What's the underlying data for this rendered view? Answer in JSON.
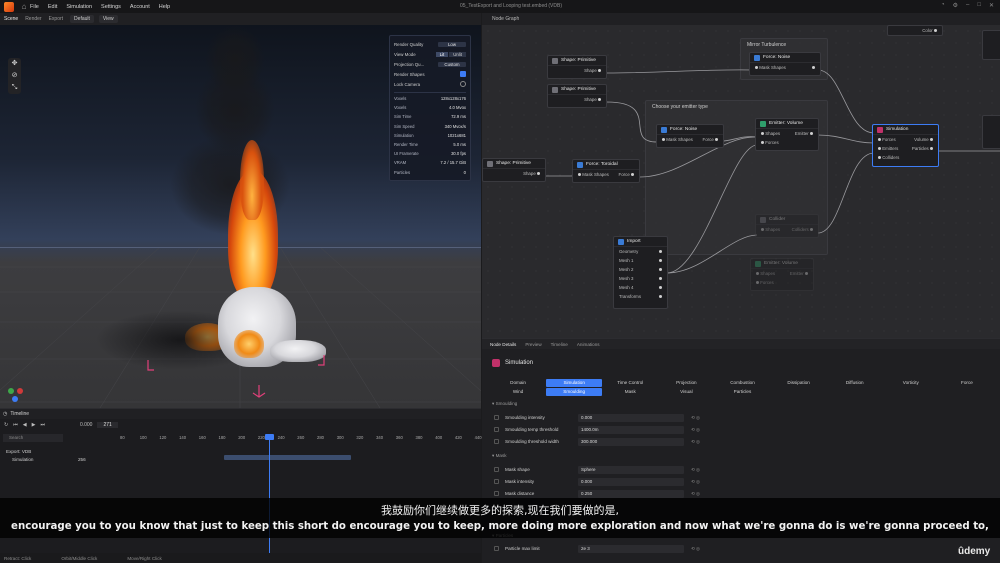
{
  "menu": {
    "items": [
      "File",
      "Edit",
      "Simulation",
      "Settings",
      "Account",
      "Help"
    ],
    "doc_title": "05_TestExport and Looping test.embed  (VDB)"
  },
  "viewport": {
    "tabs": [
      "Scene",
      "Render",
      "Export"
    ],
    "camera_preset": "Default",
    "view_menu": "View"
  },
  "render_panel": {
    "render_quality_label": "Render Quality",
    "render_quality_value": "Low",
    "view_mode_label": "View Mode",
    "view_mode_options": [
      "Lit",
      "Unlit"
    ],
    "projection_label": "Projection Qu...",
    "projection_value": "Custom",
    "render_shapes_label": "Render Shapes",
    "lock_camera_label": "Lock Camera",
    "stats": [
      {
        "label": "Voxels",
        "value": "128x128x176"
      },
      {
        "label": "Voxels",
        "value": "4.0 Mvox"
      },
      {
        "label": "Sim Time",
        "value": "72.9 ms"
      },
      {
        "label": "Sim Speed",
        "value": "340 Mvox/s"
      },
      {
        "label": "Simulation",
        "value": "1021x681"
      },
      {
        "label": "Render Time",
        "value": "5.0 ms"
      },
      {
        "label": "UI Framerate",
        "value": "30.0 fps"
      },
      {
        "label": "VRAM",
        "value": "7.2 / 15.7 GiB"
      },
      {
        "label": "Particles",
        "value": "0"
      }
    ]
  },
  "timeline": {
    "title": "Timeline",
    "current_frame": "271",
    "start_frame": "0.000",
    "search_placeholder": "Search",
    "ruler": [
      "80",
      "100",
      "120",
      "140",
      "160",
      "180",
      "200",
      "220",
      "240",
      "260",
      "280",
      "300",
      "320",
      "340",
      "360",
      "380",
      "400",
      "420",
      "440"
    ],
    "tracks": [
      {
        "label": "Export: VDB",
        "value": ""
      },
      {
        "label": "Simulation",
        "value": "256"
      }
    ]
  },
  "status": {
    "items": [
      "Retract: Click",
      "Orbit/Middle Click",
      "Move/Right Click"
    ]
  },
  "node_graph": {
    "title": "Node Graph",
    "groups": {
      "mirror": "Mirror Turbulence",
      "emitter_type": "Choose your emitter type"
    },
    "nodes": {
      "shape1": {
        "title": "Shape: Primitive",
        "out": "Shape"
      },
      "shape2": {
        "title": "Shape: Primitive",
        "out": "Shape"
      },
      "shape3": {
        "title": "Shape: Primitive",
        "out": "Shape"
      },
      "force_noise_top": {
        "title": "Force: Noise",
        "in": "Mask Shapes"
      },
      "force_noise": {
        "title": "Force: Noise",
        "in": "Mask Shapes",
        "out": "Force"
      },
      "force_toroidal": {
        "title": "Force: Toroidal",
        "in": "Mask Shapes",
        "out": "Force"
      },
      "emitter_volume": {
        "title": "Emitter: Volume",
        "in1": "Shapes",
        "in2": "Forces",
        "out": "Emitter"
      },
      "simulation": {
        "title": "Simulation",
        "rows": [
          [
            "Forces",
            "Volume"
          ],
          [
            "Emitters",
            "Particles"
          ],
          [
            "Colliders",
            ""
          ]
        ]
      },
      "import": {
        "title": "Import",
        "rows": [
          "Geometry",
          "Mesh 1",
          "Mesh 2",
          "Mesh 3",
          "Mesh 4",
          "Transforms"
        ]
      },
      "collider": {
        "title": "Collider",
        "in": "Shapes",
        "out": "Colliders"
      },
      "emitter_volume2": {
        "title": "Emitter: Volume",
        "in1": "Shapes",
        "in2": "Forces",
        "out": "Emitter"
      },
      "color": {
        "title": "Color"
      }
    }
  },
  "details": {
    "tabs": [
      "Node Details",
      "Preview",
      "Timeline",
      "Animations"
    ],
    "title": "Simulation",
    "categories_row1": [
      "Domain",
      "Simulation",
      "Time Control",
      "Projection",
      "Combustion",
      "Dissipation",
      "Diffusion",
      "Vorticity",
      "Force"
    ],
    "categories_row2": [
      "Wind",
      "Smoulding",
      "Mask",
      "Visual",
      "Particles"
    ],
    "section_smoulding": "Smoulding",
    "props_smoulding": [
      {
        "label": "Smoulding intensity",
        "value": "0.000"
      },
      {
        "label": "Smoulding temp threshold",
        "value": "1400.0m"
      },
      {
        "label": "Smoulding threshold width",
        "value": "300.000"
      }
    ],
    "section_mask": "Mask",
    "props_mask": [
      {
        "label": "Mask shape",
        "value": "Sphere"
      },
      {
        "label": "Mask intensity",
        "value": "0.000"
      },
      {
        "label": "Mask distance",
        "value": "0.250"
      }
    ],
    "section_particles": "Particles",
    "props_particles": [
      {
        "label": "Particle max limit",
        "value": "2e 3"
      }
    ]
  },
  "subtitles": {
    "zh": "我鼓励你们继续做更多的探索,现在我们要做的是,",
    "en": "encourage you to you know that just to keep this short do encourage you to keep, more doing more exploration and now what we're gonna do is we're gonna proceed to,"
  },
  "watermark": "ûdemy",
  "colors": {
    "accent": "#3d7cf5",
    "simulation_icon": "#c2316a"
  }
}
